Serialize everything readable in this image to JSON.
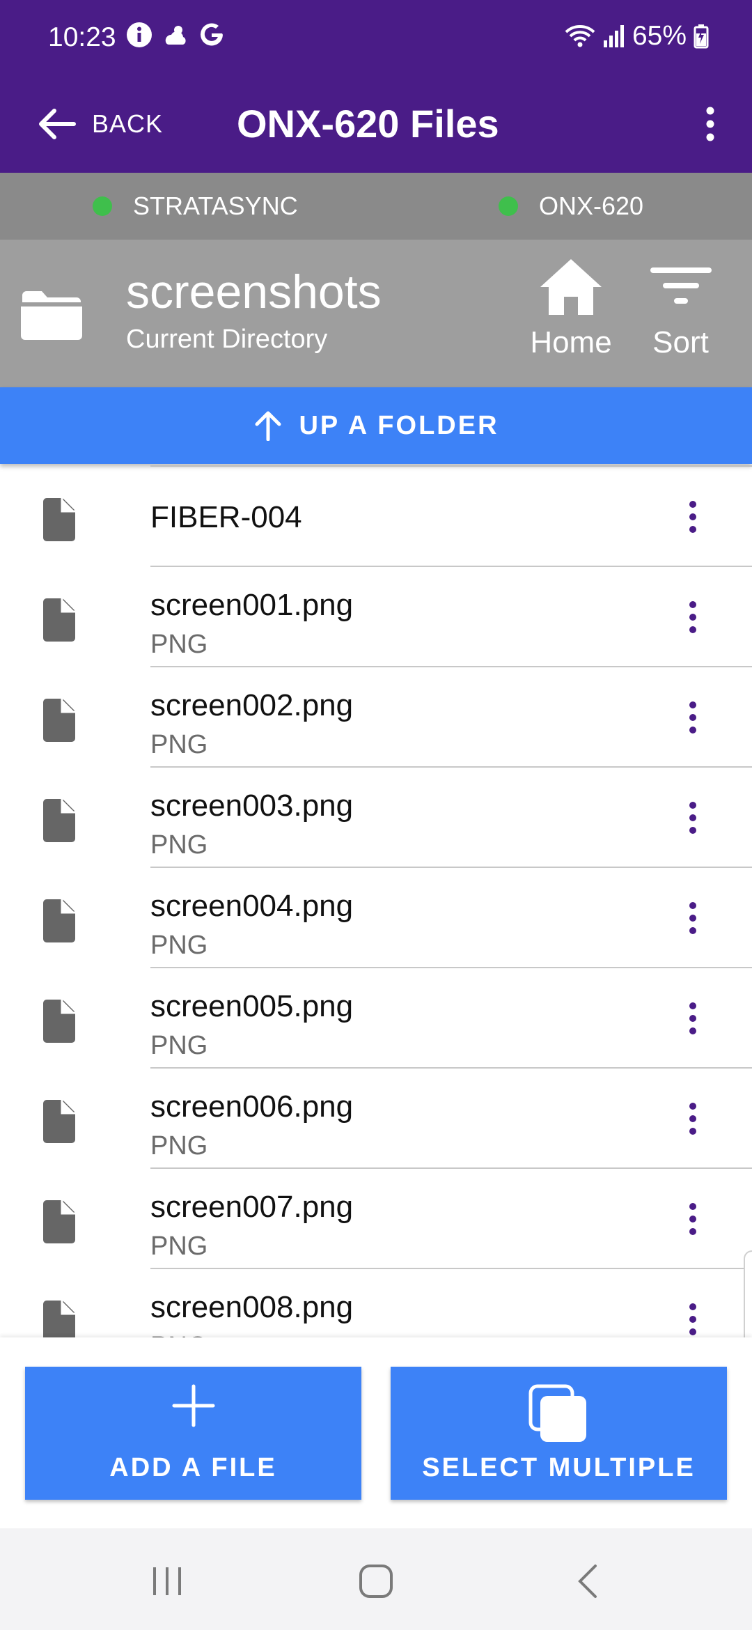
{
  "status_bar": {
    "time": "10:23",
    "battery": "65%"
  },
  "app_bar": {
    "back_label": "BACK",
    "title": "ONX-620 Files"
  },
  "connections": [
    {
      "label": "STRATASYNC",
      "status_color": "#3fbf4c"
    },
    {
      "label": "ONX-620",
      "status_color": "#3fbf4c"
    }
  ],
  "directory": {
    "name": "screenshots",
    "subtitle": "Current Directory",
    "home_label": "Home",
    "sort_label": "Sort"
  },
  "up_folder_label": "UP A FOLDER",
  "files": [
    {
      "name": "FIBER-004",
      "type": ""
    },
    {
      "name": "screen001.png",
      "type": "PNG"
    },
    {
      "name": "screen002.png",
      "type": "PNG"
    },
    {
      "name": "screen003.png",
      "type": "PNG"
    },
    {
      "name": "screen004.png",
      "type": "PNG"
    },
    {
      "name": "screen005.png",
      "type": "PNG"
    },
    {
      "name": "screen006.png",
      "type": "PNG"
    },
    {
      "name": "screen007.png",
      "type": "PNG"
    },
    {
      "name": "screen008.png",
      "type": "PNG"
    }
  ],
  "actions": {
    "add_file_label": "ADD A FILE",
    "select_multiple_label": "SELECT MULTIPLE"
  },
  "colors": {
    "header_purple": "#4a1c87",
    "accent_blue": "#3d82f7",
    "kebab_purple": "#4a1c87",
    "status_green": "#3fbf4c"
  }
}
